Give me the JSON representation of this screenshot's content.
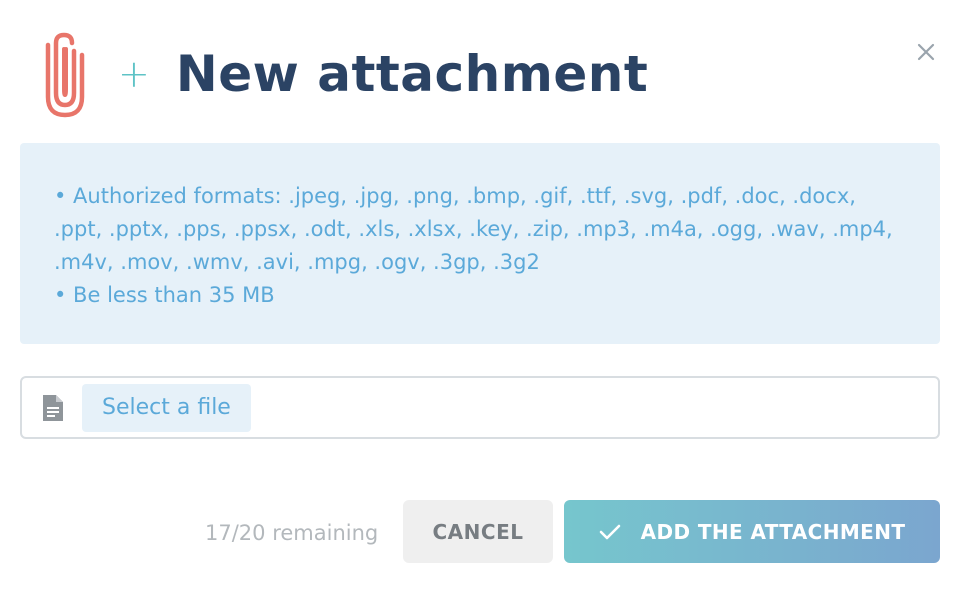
{
  "dialog": {
    "title": "New attachment",
    "plus_symbol": "+",
    "close_icon": "close-icon",
    "title_icon": "paperclip-icon"
  },
  "info": {
    "formats_text": "• Authorized formats: .jpeg, .jpg, .png, .bmp, .gif, .ttf, .svg, .pdf, .doc, .docx, .ppt, .pptx, .pps, .ppsx, .odt, .xls, .xlsx, .key, .zip, .mp3, .m4a, .ogg, .wav, .mp4, .m4v, .mov, .wmv, .avi, .mpg, .ogv, .3gp, .3g2",
    "size_text": "• Be less than 35 MB"
  },
  "file_input": {
    "icon": "document-icon",
    "select_label": "Select a file"
  },
  "footer": {
    "remaining_text": "17/20 remaining",
    "cancel_label": "CANCEL",
    "add_label": "ADD THE ATTACHMENT",
    "add_icon": "check-icon"
  },
  "colors": {
    "title": "#2b4364",
    "clip": "#e8756a",
    "plus": "#5ec3c6",
    "info_bg": "#e6f1f9",
    "info_text": "#5ba9d9",
    "add_gradient_start": "#76c6cd",
    "add_gradient_end": "#7ba6cf",
    "cancel_bg": "#efefef"
  }
}
